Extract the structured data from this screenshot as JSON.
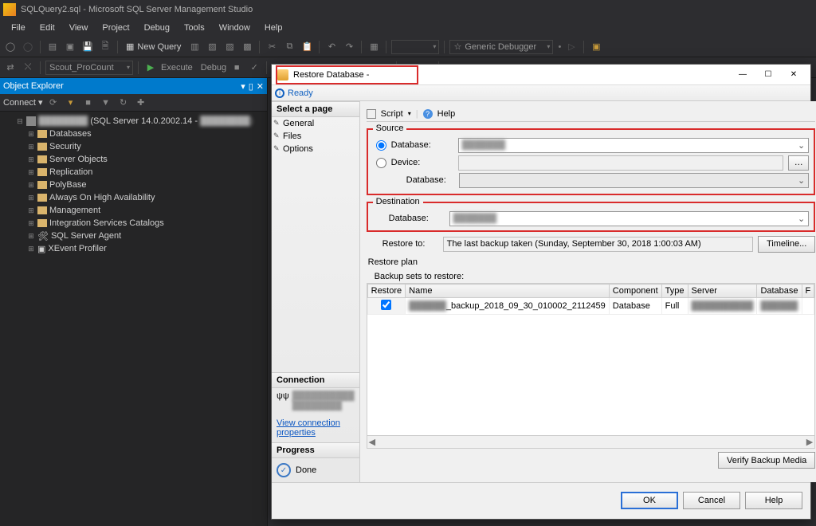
{
  "app": {
    "title": "SQLQuery2.sql - Microsoft SQL Server Management Studio"
  },
  "menu": [
    "File",
    "Edit",
    "View",
    "Project",
    "Debug",
    "Tools",
    "Window",
    "Help"
  ],
  "toolbar": {
    "new_query": "New Query",
    "db_combo": "Scout_ProCount",
    "execute": "Execute",
    "debug": "Debug",
    "debugger_combo": "Generic Debugger"
  },
  "explorer": {
    "title": "Object Explorer",
    "connect": "Connect",
    "server_version": "(SQL Server 14.0.2002.14 -",
    "nodes": [
      "Databases",
      "Security",
      "Server Objects",
      "Replication",
      "PolyBase",
      "Always On High Availability",
      "Management",
      "Integration Services Catalogs",
      "SQL Server Agent",
      "XEvent Profiler"
    ]
  },
  "dialog": {
    "title": "Restore Database -",
    "ready": "Ready",
    "select_page": "Select a page",
    "pages": [
      "General",
      "Files",
      "Options"
    ],
    "connection_hdr": "Connection",
    "view_conn": "View connection properties",
    "progress_hdr": "Progress",
    "progress_status": "Done",
    "script": "Script",
    "help": "Help",
    "source_hdr": "Source",
    "src_database_lbl": "Database:",
    "src_device_lbl": "Device:",
    "src_database2_lbl": "Database:",
    "dest_hdr": "Destination",
    "dest_database_lbl": "Database:",
    "restore_to_lbl": "Restore to:",
    "restore_to_val": "The last backup taken (Sunday, September 30, 2018 1:00:03 AM)",
    "timeline_btn": "Timeline...",
    "plan_hdr": "Restore plan",
    "plan_sub": "Backup sets to restore:",
    "grid_cols": [
      "Restore",
      "Name",
      "Component",
      "Type",
      "Server",
      "Database",
      "F"
    ],
    "grid_row": {
      "name_suffix": "_backup_2018_09_30_010002_2112459",
      "component": "Database",
      "type": "Full"
    },
    "verify_btn": "Verify Backup Media",
    "ok": "OK",
    "cancel": "Cancel",
    "help_btn": "Help"
  }
}
